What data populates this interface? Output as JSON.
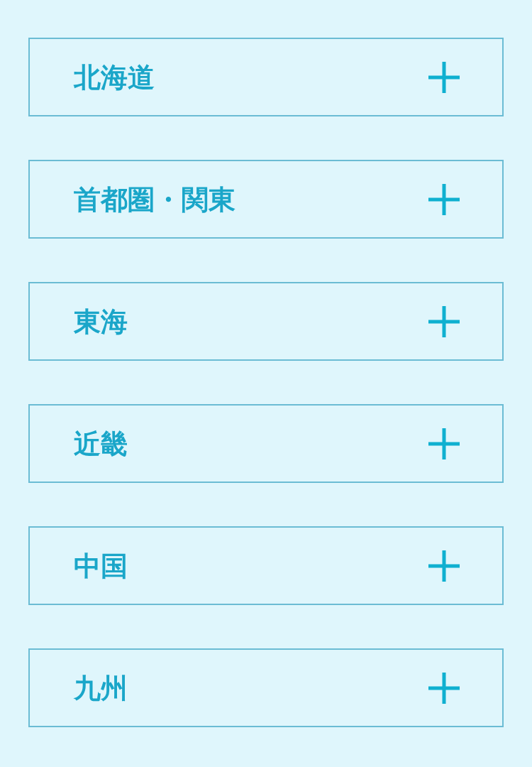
{
  "regions": [
    {
      "label": "北海道",
      "expanded": false
    },
    {
      "label": "首都圏・関東",
      "expanded": false
    },
    {
      "label": "東海",
      "expanded": false
    },
    {
      "label": "近畿",
      "expanded": false
    },
    {
      "label": "中国",
      "expanded": false
    },
    {
      "label": "九州",
      "expanded": false
    }
  ]
}
